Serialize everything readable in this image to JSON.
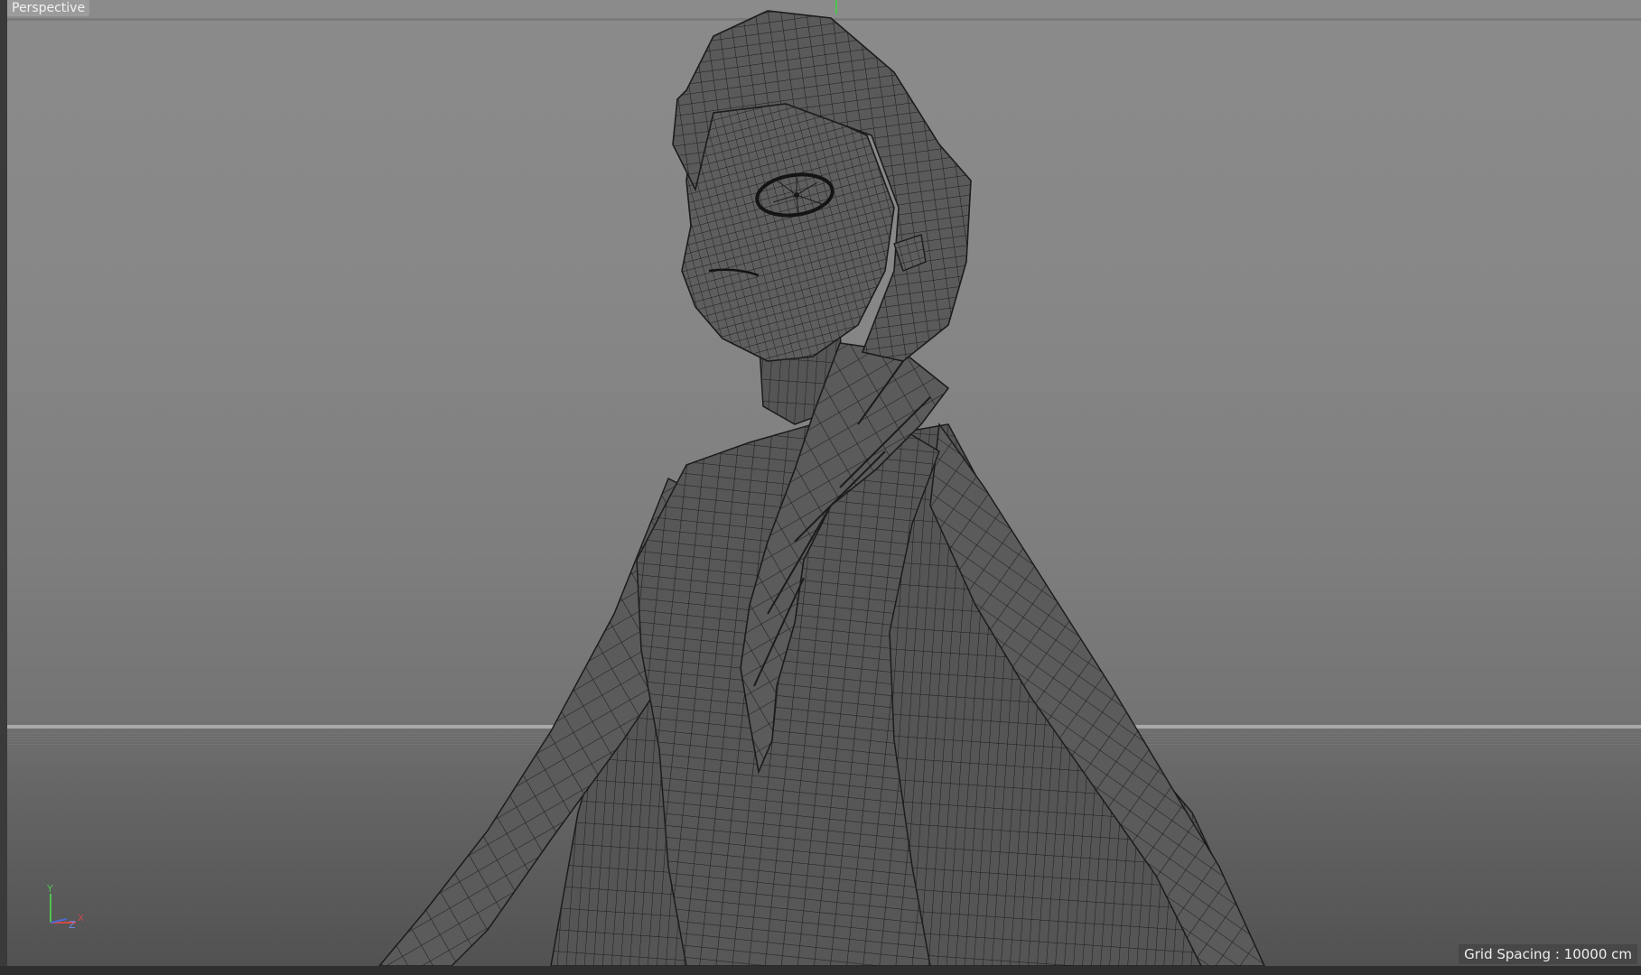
{
  "viewport": {
    "view_name": "Perspective",
    "grid_spacing": "Grid Spacing : 10000 cm",
    "display_mode": "wireframe"
  },
  "axis_gizmo": {
    "y_label": "Y",
    "z_label": "Z",
    "x_label": "X"
  },
  "colors": {
    "background": "#888888",
    "mesh_fill": "#5a5a5a",
    "wire": "#1c1c1c",
    "axis_y": "#4fc24f",
    "axis_x": "#d04a4a",
    "axis_z": "#4a6ad0"
  }
}
